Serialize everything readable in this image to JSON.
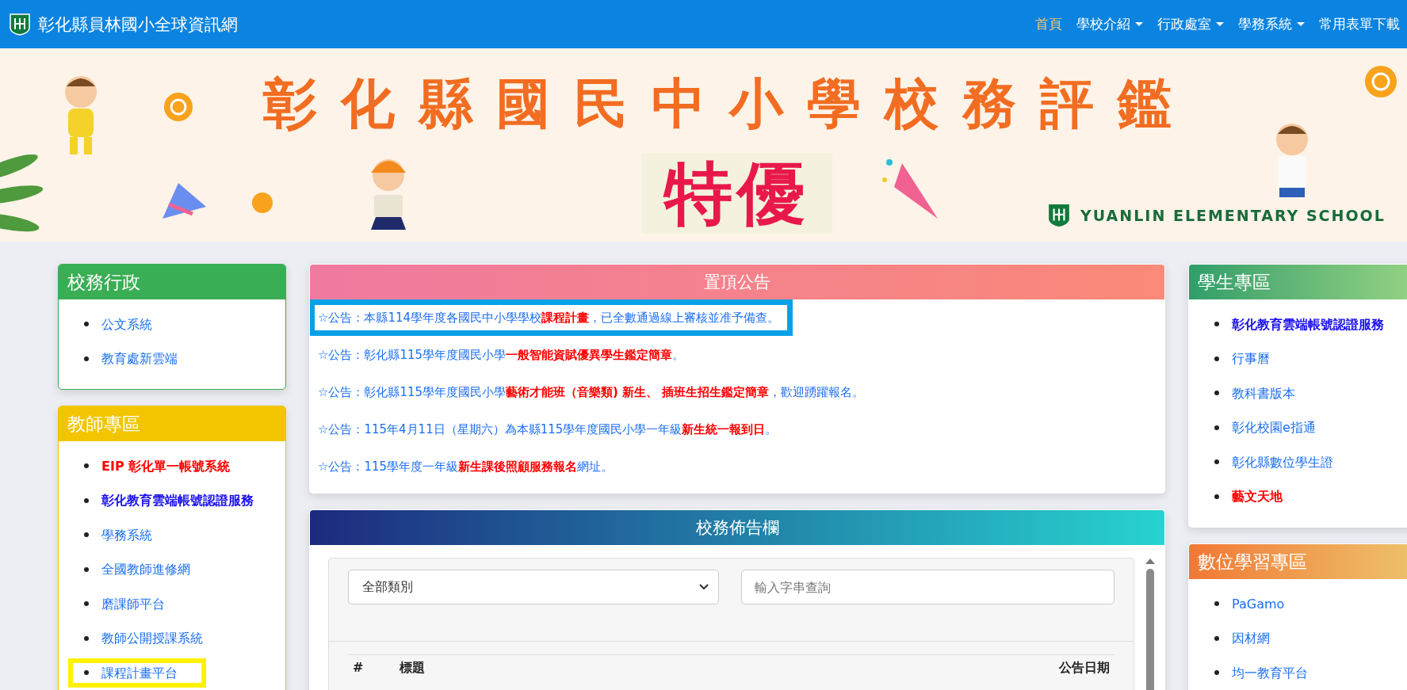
{
  "navbar": {
    "site_title": "彰化縣員林國小全球資訊網",
    "menu": [
      {
        "label": "首頁",
        "selected": true,
        "dropdown": false
      },
      {
        "label": "學校介紹",
        "selected": false,
        "dropdown": true
      },
      {
        "label": "行政處室",
        "selected": false,
        "dropdown": true
      },
      {
        "label": "學務系統",
        "selected": false,
        "dropdown": true
      },
      {
        "label": "常用表單下載",
        "selected": false,
        "dropdown": false
      }
    ]
  },
  "banner": {
    "headline": "彰化縣國民中小學校務評鑑",
    "award": "特優",
    "school_name": "YUANLIN ELEMENTARY SCHOOL"
  },
  "left_sidebar": [
    {
      "title": "校務行政",
      "color": "#3aae55",
      "gradient": false,
      "items": [
        {
          "label": "公文系統",
          "kind": "link",
          "highlighted": false
        },
        {
          "label": "教育處新雲端",
          "kind": "link",
          "highlighted": false
        }
      ]
    },
    {
      "title": "教師專區",
      "color": "#f2c500",
      "gradient": false,
      "items": [
        {
          "label": "EIP 彰化單一帳號系統",
          "kind": "alert",
          "highlighted": false
        },
        {
          "label": "彰化教育雲端帳號認證服務",
          "kind": "strong",
          "highlighted": false
        },
        {
          "label": "學務系統",
          "kind": "link",
          "highlighted": false
        },
        {
          "label": "全國教師進修網",
          "kind": "link",
          "highlighted": false
        },
        {
          "label": "磨課師平台",
          "kind": "link",
          "highlighted": false
        },
        {
          "label": "教師公開授課系統",
          "kind": "link",
          "highlighted": false
        },
        {
          "label": "課程計畫平台",
          "kind": "link",
          "highlighted": true
        }
      ]
    }
  ],
  "pinned_announcements": {
    "title": "置頂公告",
    "items": [
      {
        "text": "☆公告：本縣114學年度各國民中小學學校**課程計畫**，已全數通過線上審核並准予備查。",
        "highlighted": true
      },
      {
        "text": "☆公告：彰化縣115學年度國民小學**一般智能資賦優異學生鑑定簡章**。",
        "highlighted": false
      },
      {
        "text": "☆公告：彰化縣115學年度國民小學**藝術才能班（音樂類) 新生、 插班生招生鑑定簡章**，歡迎踴躍報名。",
        "highlighted": false
      },
      {
        "text": "☆公告：115年4月11日（星期六）為本縣115學年度國民小學一年級**新生統一報到日**。",
        "highlighted": false
      },
      {
        "text": "☆公告：115學年度一年級**新生課後照顧服務報名**網址。",
        "highlighted": false
      }
    ]
  },
  "bulletin_board": {
    "title": "校務佈告欄",
    "category_select": {
      "value": "全部類別"
    },
    "search": {
      "placeholder": "輸入字串查詢"
    },
    "table": {
      "columns": [
        "#",
        "標題",
        "公告日期"
      ]
    }
  },
  "right_sidebar": [
    {
      "title": "學生專區",
      "color": "#2e9e6a",
      "gradient": true,
      "items": [
        {
          "label": "彰化教育雲端帳號認證服務",
          "kind": "strong",
          "highlighted": false
        },
        {
          "label": "行事曆",
          "kind": "link",
          "highlighted": false
        },
        {
          "label": "教科書版本",
          "kind": "link",
          "highlighted": false
        },
        {
          "label": "彰化校園e指通",
          "kind": "link",
          "highlighted": false
        },
        {
          "label": "彰化縣數位學生證",
          "kind": "link",
          "highlighted": false
        },
        {
          "label": "藝文天地",
          "kind": "alert",
          "highlighted": false
        }
      ]
    },
    {
      "title": "數位學習專區",
      "color": "#f07834",
      "gradient": true,
      "items": [
        {
          "label": "PaGamo",
          "kind": "link",
          "highlighted": false
        },
        {
          "label": "因材網",
          "kind": "link",
          "highlighted": false
        },
        {
          "label": "均一教育平台",
          "kind": "link",
          "highlighted": false
        }
      ]
    }
  ]
}
